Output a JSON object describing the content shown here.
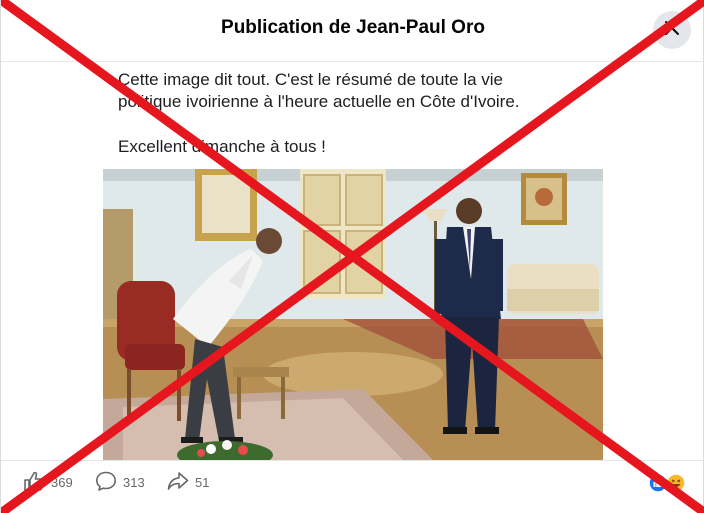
{
  "header": {
    "title": "Publication de Jean-Paul Oro"
  },
  "post": {
    "text_line1": "Cette image dit tout. C'est le résumé de toute la vie",
    "text_line2": "politique ivoirienne à l'heure actuelle en Côte d'Ivoire.",
    "text_line3": "Excellent dimanche à tous !"
  },
  "stats": {
    "likes": "369",
    "comments": "313",
    "shares": "51"
  },
  "icons": {
    "close": "close-icon",
    "like": "thumbs-up-icon",
    "comment": "comment-icon",
    "share": "share-icon",
    "reactions": [
      "like-reaction-icon",
      "haha-reaction-icon"
    ]
  },
  "colors": {
    "cross": "#e5161e",
    "like_blue": "#1877f2",
    "reaction_yellow": "#f7b928"
  }
}
